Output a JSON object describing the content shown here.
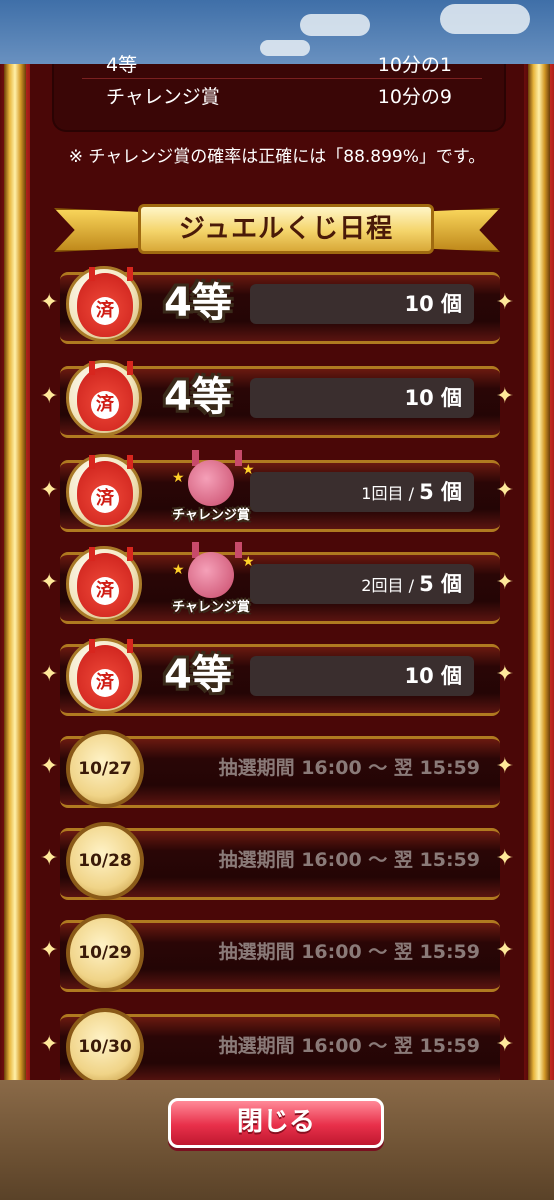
{
  "info_table": {
    "rows": [
      {
        "label": "4等",
        "value": "10分の1"
      },
      {
        "label": "チャレンジ賞",
        "value": "10分の9"
      }
    ]
  },
  "note": "※ チャレンジ賞の確率は正確には「88.899%」です。",
  "schedule": {
    "title": "ジュエルくじ日程",
    "completed": [
      {
        "stamp": "済",
        "prize": "4等",
        "count_text": "10 個"
      },
      {
        "stamp": "済",
        "prize": "4等",
        "count_text": "10 個"
      },
      {
        "stamp": "済",
        "prize": "チャレンジ賞",
        "attempt": "1回目 /",
        "count_text": "5 個"
      },
      {
        "stamp": "済",
        "prize": "チャレンジ賞",
        "attempt": "2回目 /",
        "count_text": "5 個"
      },
      {
        "stamp": "済",
        "prize": "4等",
        "count_text": "10 個"
      }
    ],
    "upcoming": [
      {
        "date": "10/27",
        "period": "抽選期間 16:00 〜 翌 15:59"
      },
      {
        "date": "10/28",
        "period": "抽選期間 16:00 〜 翌 15:59"
      },
      {
        "date": "10/29",
        "period": "抽選期間 16:00 〜 翌 15:59"
      },
      {
        "date": "10/30",
        "period": "抽選期間 16:00 〜 翌 15:59"
      }
    ]
  },
  "close_button": "閉じる",
  "colors": {
    "curtain": "#9e1a1a",
    "gold": "#e8b63c",
    "close_button": "#e8304a"
  }
}
